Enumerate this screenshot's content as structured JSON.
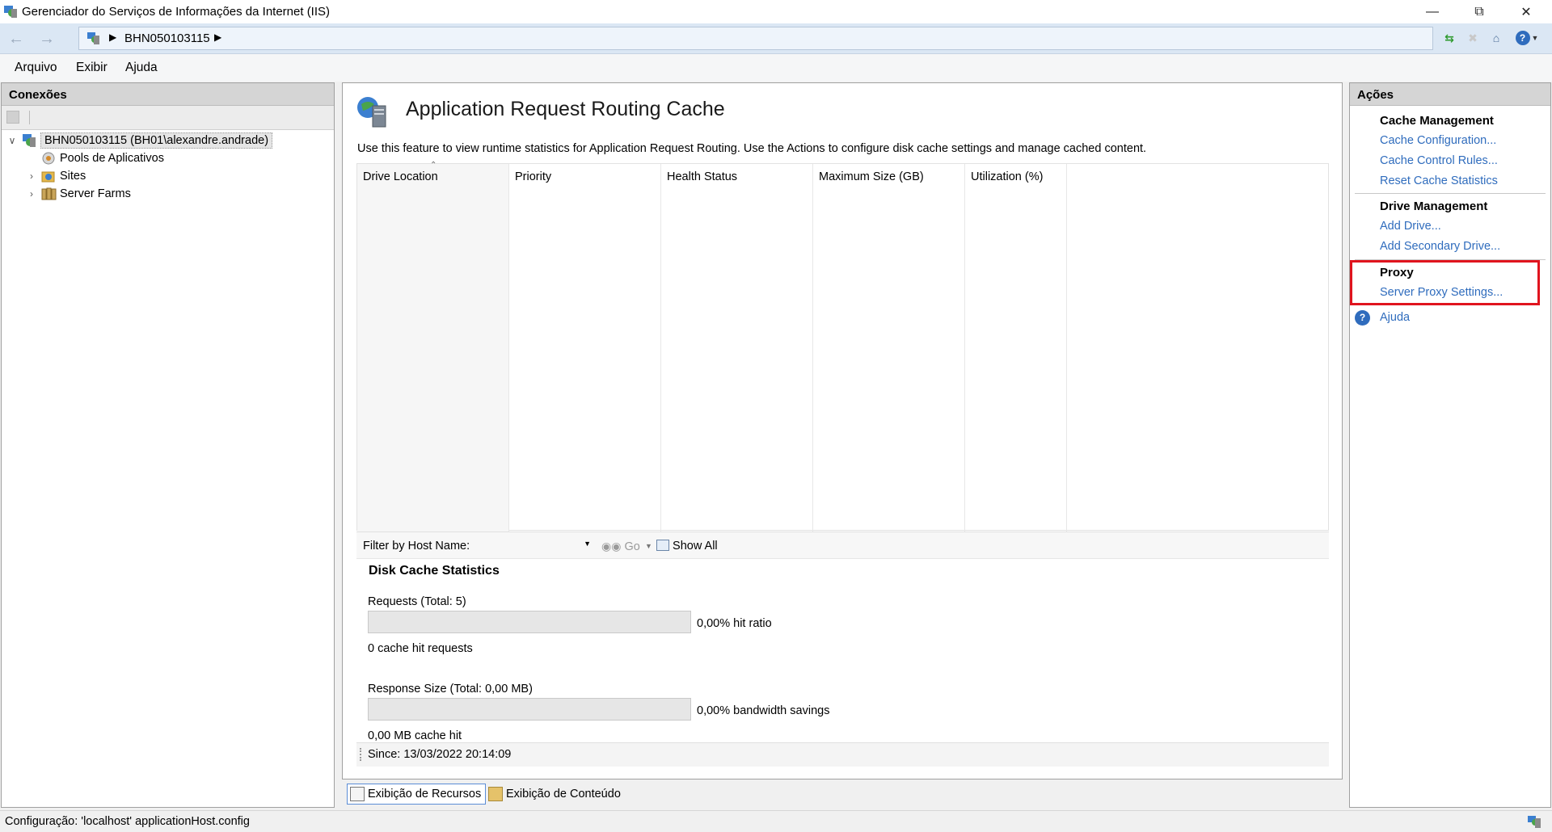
{
  "window": {
    "title": "Gerenciador do Serviços de Informações da Internet (IIS)",
    "app_icon": "iis-manager-icon"
  },
  "address": {
    "back_icon": "back-arrow-icon",
    "forward_icon": "forward-arrow-icon",
    "breadcrumb": "BHN050103115",
    "toolbar_icons": [
      "refresh-icon",
      "stop-icon",
      "home-icon",
      "help-icon"
    ]
  },
  "menu": {
    "items": [
      "Arquivo",
      "Exibir",
      "Ajuda"
    ]
  },
  "connections": {
    "header": "Conexões",
    "tree": {
      "server": "BHN050103115 (BH01\\alexandre.andrade)",
      "children": [
        "Pools de Aplicativos",
        "Sites",
        "Server Farms"
      ]
    }
  },
  "main": {
    "title": "Application Request Routing Cache",
    "description": "Use this feature to view runtime statistics for Application Request Routing.  Use the Actions to configure disk cache settings and manage cached content.",
    "columns": [
      "Drive Location",
      "Priority",
      "Health Status",
      "Maximum Size (GB)",
      "Utilization (%)"
    ],
    "rows": [],
    "filter": {
      "label": "Filter by Host Name:",
      "value": "",
      "go_label": "Go",
      "show_all_label": "Show All"
    },
    "stats": {
      "heading": "Disk Cache Statistics",
      "requests_label": "Requests (Total: 5)",
      "requests_ratio": 0.0,
      "requests_ratio_text": "0,00% hit ratio",
      "cache_hit_requests": "0 cache hit requests",
      "response_label": "Response Size (Total: 0,00 MB)",
      "bandwidth_ratio": 0.0,
      "bandwidth_text": "0,00% bandwidth savings",
      "mb_cache_hit": "0,00 MB cache hit",
      "since": "Since: 13/03/2022 20:14:09"
    }
  },
  "tabs": {
    "features_view": "Exibição de Recursos",
    "content_view": "Exibição de Conteúdo"
  },
  "actions": {
    "header": "Ações",
    "groups": [
      {
        "title": "Cache Management",
        "links": [
          "Cache Configuration...",
          "Cache Control Rules...",
          "Reset Cache Statistics"
        ]
      },
      {
        "title": "Drive Management",
        "links": [
          "Add Drive...",
          "Add Secondary Drive..."
        ]
      },
      {
        "title": "Proxy",
        "links": [
          "Server Proxy Settings..."
        ]
      }
    ],
    "help": "Ajuda"
  },
  "status": {
    "text": "Configuração: 'localhost' applicationHost.config"
  }
}
